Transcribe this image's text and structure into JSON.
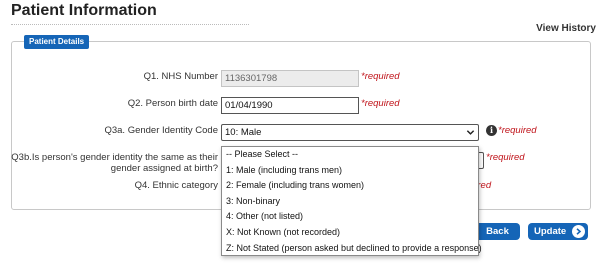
{
  "header": {
    "title": "Patient Information",
    "view_history": "View History"
  },
  "panel": {
    "tab_label": "Patient Details"
  },
  "form": {
    "q1": {
      "label": "Q1. NHS Number",
      "value": "1136301798",
      "required": "*required"
    },
    "q2": {
      "label": "Q2. Person birth date",
      "value": "01/04/1990",
      "required": "*required"
    },
    "q3a": {
      "label": "Q3a. Gender Identity Code",
      "value": "10: Male",
      "required": "*required"
    },
    "q3b": {
      "label_line1": "Q3b.Is person's gender identity the same as their",
      "label_line2": "gender assigned at birth?",
      "required": "*required"
    },
    "q4": {
      "label": "Q4. Ethnic category",
      "required_partial": "uired"
    }
  },
  "dropdown": {
    "options": [
      "-- Please Select --",
      "1: Male (including trans men)",
      "2: Female (including trans women)",
      "3: Non-binary",
      "4: Other (not listed)",
      "X: Not Known (not recorded)",
      "Z: Not Stated (person asked but declined to provide a response)"
    ]
  },
  "buttons": {
    "back": "Back",
    "update": "Update"
  },
  "colors": {
    "primary": "#1565b7",
    "required": "#c0141b"
  }
}
